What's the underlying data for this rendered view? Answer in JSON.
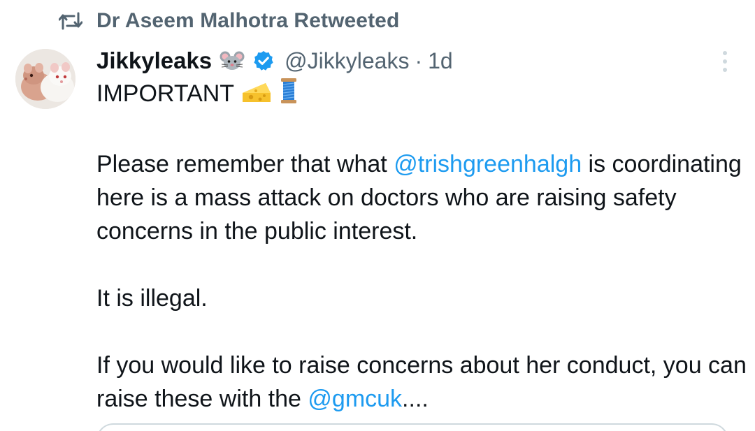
{
  "retweet": {
    "text": "Dr Aseem Malhotra Retweeted",
    "icon": "retweet-icon"
  },
  "author": {
    "display_name": "Jikkyleaks",
    "name_emoji": "mouse-face-icon",
    "verified_icon": "verified-badge-icon",
    "handle": "@Jikkyleaks",
    "separator": "·",
    "time": "1d",
    "avatar": "two-rats-avatar"
  },
  "tweet": {
    "line1": "IMPORTANT",
    "line1_emojis": [
      "cheese-icon",
      "thread-spool-icon"
    ],
    "p2_part1": "Please remember that what ",
    "p2_mention": "@trishgreenhalgh",
    "p2_part2": " is coordinating here is a mass attack on doctors who are raising safety concerns in the public interest.",
    "p3": "It is illegal.",
    "p4_part1": "If you would like to raise concerns about her conduct, you can raise these with the ",
    "p4_mention": "@gmcuk",
    "p4_part2": "...."
  },
  "colors": {
    "text": "#0f1419",
    "secondary": "#536471",
    "link": "#1d9bf0",
    "verified": "#1d9bf0"
  }
}
